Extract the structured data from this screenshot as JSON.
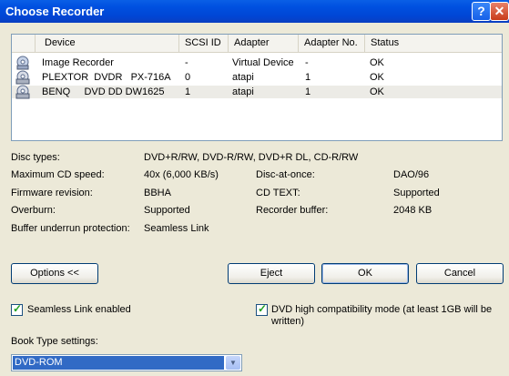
{
  "window": {
    "title": "Choose Recorder",
    "help_label": "?",
    "close_label": "✕"
  },
  "devices": {
    "columns": [
      "Device",
      "SCSI ID",
      "Adapter",
      "Adapter No.",
      "Status"
    ],
    "rows": [
      {
        "device": "Image Recorder",
        "scsi_id": "-",
        "adapter": "Virtual Device",
        "adapter_no": "-",
        "status": "OK",
        "icon": "image-recorder-icon"
      },
      {
        "device": "PLEXTOR  DVDR   PX-716A",
        "scsi_id": "0",
        "adapter": "atapi",
        "adapter_no": "1",
        "status": "OK",
        "icon": "optical-drive-icon"
      },
      {
        "device": "BENQ     DVD DD DW1625",
        "scsi_id": "1",
        "adapter": "atapi",
        "adapter_no": "1",
        "status": "OK",
        "icon": "optical-drive-icon",
        "selected": true
      }
    ]
  },
  "info": {
    "disc_types_label": "Disc types:",
    "disc_types_value": "DVD+R/RW, DVD-R/RW, DVD+R DL, CD-R/RW",
    "max_speed_label": "Maximum CD speed:",
    "max_speed_value": "40x (6,000 KB/s)",
    "firmware_label": "Firmware revision:",
    "firmware_value": "BBHA",
    "overburn_label": "Overburn:",
    "overburn_value": "Supported",
    "buffer_protection_label": "Buffer underrun protection:",
    "buffer_protection_value": "Seamless Link",
    "disc_at_once_label": "Disc-at-once:",
    "disc_at_once_value": "DAO/96",
    "cd_text_label": "CD TEXT:",
    "cd_text_value": "Supported",
    "recorder_buffer_label": "Recorder buffer:",
    "recorder_buffer_value": "2048 KB"
  },
  "buttons": {
    "options": "Options <<",
    "eject": "Eject",
    "ok": "OK",
    "cancel": "Cancel"
  },
  "options": {
    "seamless_link_label": "Seamless Link enabled",
    "seamless_link_checked": true,
    "dvd_compat_label_line1": "DVD high compatibility mode (at least 1GB will be",
    "dvd_compat_label_line2": "written)",
    "dvd_compat_checked": true,
    "book_type_label": "Book Type settings:",
    "book_type_value": "DVD-ROM"
  },
  "colors": {
    "titlebar": "#0050e0",
    "selection": "#316ac5",
    "dialog_bg": "#ece9d8"
  }
}
